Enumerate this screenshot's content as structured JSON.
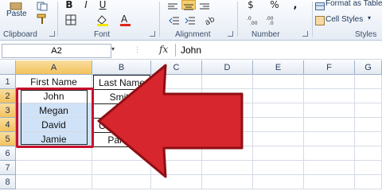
{
  "ribbon": {
    "clipboard": {
      "paste_label": "Paste",
      "group_label": "Clipboard"
    },
    "font": {
      "bold": "B",
      "italic": "I",
      "underline": "U",
      "group_label": "Font"
    },
    "alignment": {
      "group_label": "Alignment"
    },
    "number": {
      "currency": "$",
      "percent": "%",
      "comma": ",",
      "group_label": "Number"
    },
    "styles": {
      "format_as_table": "Format as Table",
      "cell_styles": "Cell Styles",
      "group_label": "Styles"
    }
  },
  "formula_bar": {
    "name_box": "A2",
    "fx": "fx",
    "value": "John"
  },
  "columns": [
    "A",
    "B",
    "C",
    "D",
    "E",
    "F",
    "G"
  ],
  "rows": [
    "1",
    "2",
    "3",
    "4",
    "5",
    "6",
    "7",
    "8"
  ],
  "cells": {
    "A1": "First Name",
    "B1": "Last Name",
    "A2": "John",
    "B2": "Smith",
    "A3": "Megan",
    "A4": "David",
    "B4": "Ca",
    "A5": "Jamie",
    "B5": "Parker"
  },
  "colors": {
    "highlight_fill": "#cfe2f7",
    "selection_border": "#c8102e",
    "arrow": "#d7262e"
  }
}
